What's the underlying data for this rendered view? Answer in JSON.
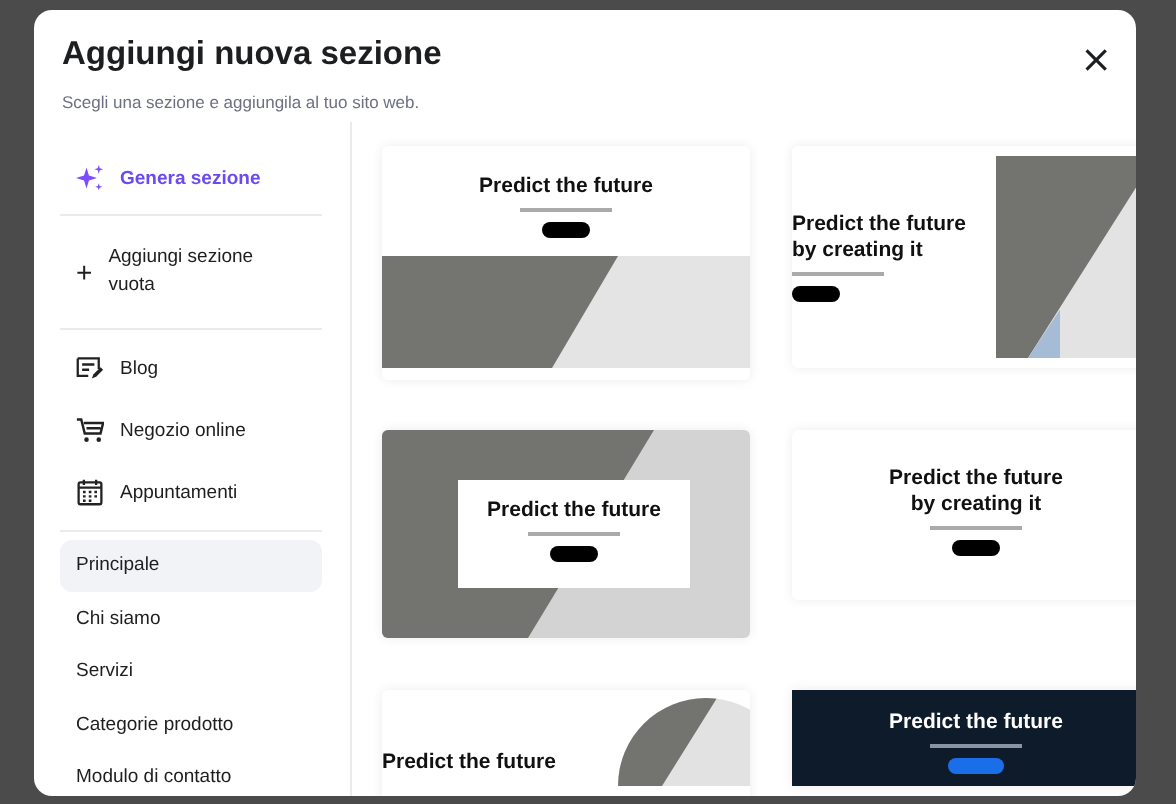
{
  "dialog": {
    "title": "Aggiungi nuova sezione",
    "subtitle": "Scegli una sezione e aggiungila al tuo sito web.",
    "close": "×"
  },
  "sidebar": {
    "actions": [
      {
        "kind": "generate",
        "label": "Genera sezione"
      },
      {
        "kind": "add",
        "icon": "+",
        "label": "Aggiungi sezione vuota"
      }
    ],
    "features": [
      {
        "kind": "blog",
        "label": "Blog"
      },
      {
        "kind": "shop",
        "label": "Negozio online"
      },
      {
        "kind": "booking",
        "label": "Appuntamenti"
      }
    ],
    "categories": [
      {
        "label": "Principale",
        "selected": true
      },
      {
        "label": "Chi siamo",
        "selected": false
      },
      {
        "label": "Servizi",
        "selected": false
      },
      {
        "label": "Categorie prodotto",
        "selected": false
      },
      {
        "label": "Modulo di contatto",
        "selected": false
      }
    ]
  },
  "templates": [
    {
      "kind": "image-bottom",
      "title": "Predict the future"
    },
    {
      "kind": "split",
      "title": "Predict the future\nby creating it"
    },
    {
      "kind": "overlay",
      "title": "Predict the future"
    },
    {
      "kind": "centered",
      "title": "Predict the future\nby creating it"
    },
    {
      "kind": "circle",
      "title": "Predict the future"
    },
    {
      "kind": "dark",
      "title": "Predict the future"
    }
  ]
}
